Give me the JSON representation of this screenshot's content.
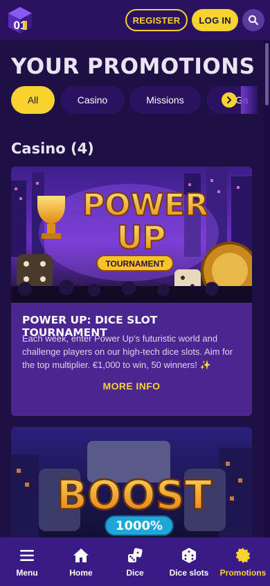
{
  "header": {
    "logo_text": "01",
    "register_label": "REGISTER",
    "login_label": "LOG IN",
    "search_icon": "search-icon"
  },
  "page_title": "YOUR PROMOTIONS",
  "tabs": [
    {
      "label": "All",
      "active": true
    },
    {
      "label": "Casino",
      "active": false
    },
    {
      "label": "Missions",
      "active": false
    },
    {
      "label": "Ga",
      "active": false
    }
  ],
  "section": {
    "title": "Casino (4)"
  },
  "promotions": [
    {
      "banner_line1": "POWER",
      "banner_line2": "UP",
      "banner_ribbon": "TOURNAMENT",
      "title": "POWER UP: DICE SLOT TOURNAMENT",
      "description": "Each week, enter Power Up's futuristic world and challenge players on our high-tech dice slots. Aim for the top multiplier. €1,000 to win, 50 winners! ✨",
      "more_label": "MORE INFO"
    },
    {
      "banner_line1": "BOOST",
      "banner_badge": "1000%"
    }
  ],
  "bottom_nav": [
    {
      "label": "Menu",
      "icon": "menu-icon"
    },
    {
      "label": "Home",
      "icon": "home-icon"
    },
    {
      "label": "Dice",
      "icon": "dice-icon"
    },
    {
      "label": "Dice slots",
      "icon": "dice-slots-icon"
    },
    {
      "label": "Promotions",
      "icon": "promotions-icon",
      "active": true
    }
  ],
  "colors": {
    "background": "#1e0f45",
    "header": "#2a1260",
    "accent": "#f7d330",
    "card": "#4b2590",
    "nav": "#3a1b86"
  }
}
